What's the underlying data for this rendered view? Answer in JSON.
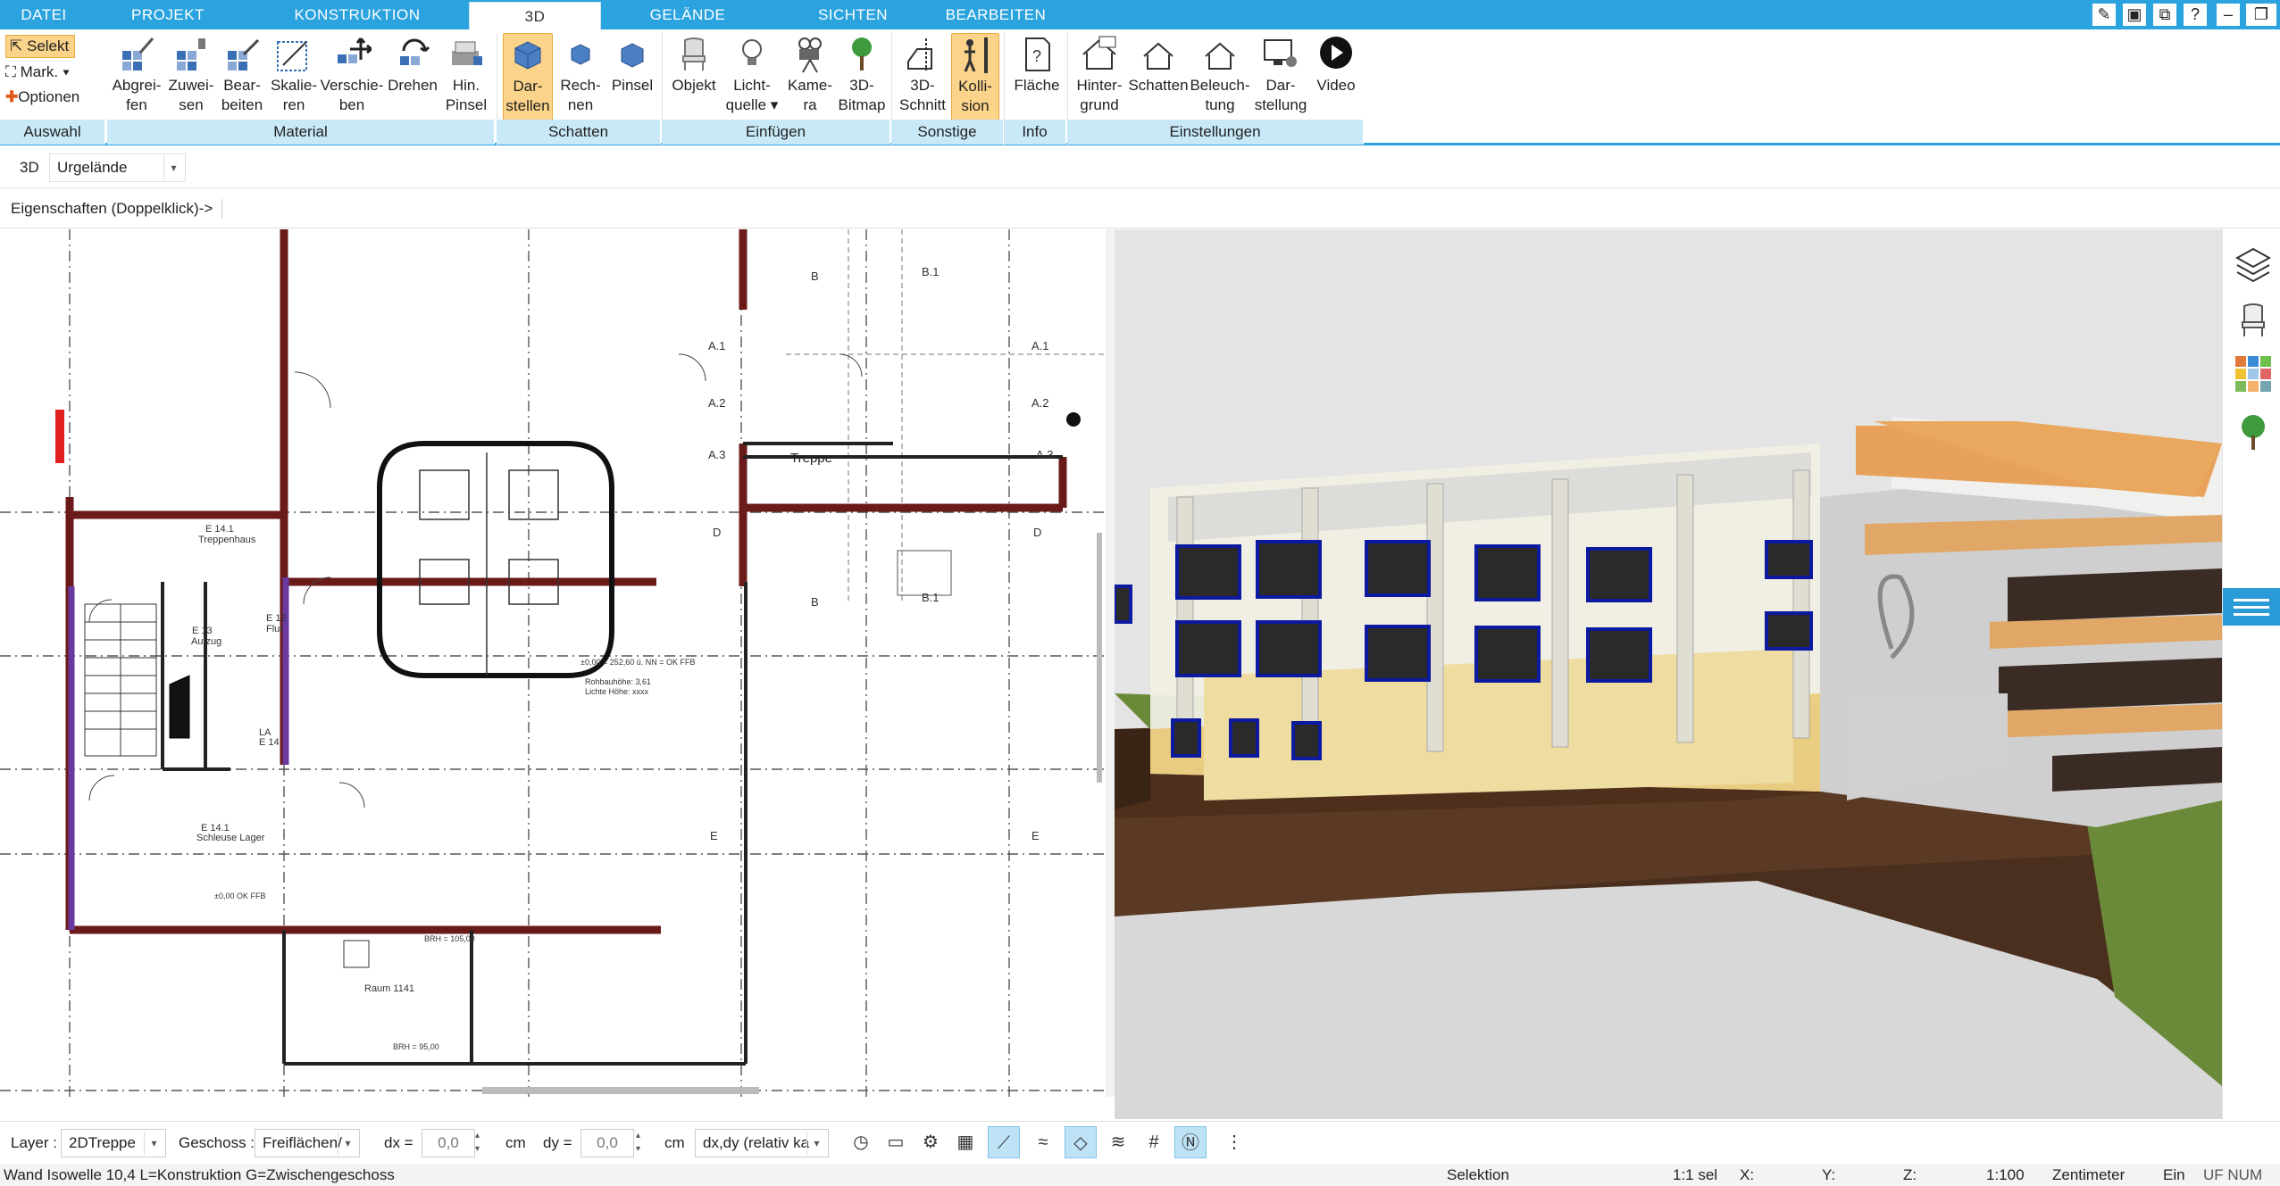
{
  "tabs": [
    "DATEI",
    "PROJEKT",
    "KONSTRUKTION",
    "3D",
    "GELÄNDE",
    "SICHTEN",
    "BEARBEITEN"
  ],
  "window_controls": [
    "tools-icon",
    "screen-icon",
    "restore-icon",
    "help-icon",
    "minimize",
    "restore",
    "close"
  ],
  "ribbon": {
    "auswahl": {
      "selekt": "Selekt",
      "mark": "Mark.",
      "optionen": "Optionen",
      "group": "Auswahl"
    },
    "material": {
      "group": "Material",
      "buttons": [
        [
          "Abgrei-",
          "fen"
        ],
        [
          "Zuwei-",
          "sen"
        ],
        [
          "Bear-",
          "beiten"
        ],
        [
          "Skalie-",
          "ren"
        ],
        [
          "Verschie-",
          "ben"
        ],
        [
          "Drehen",
          ""
        ],
        [
          "Hin.",
          "Pinsel"
        ]
      ]
    },
    "schatten": {
      "group": "Schatten",
      "buttons": [
        [
          "Dar-",
          "stellen"
        ],
        [
          "Rech-",
          "nen"
        ],
        [
          "Pinsel",
          ""
        ]
      ]
    },
    "einfuegen": {
      "group": "Einfügen",
      "buttons": [
        [
          "Objekt",
          ""
        ],
        [
          "Licht-",
          "quelle ▾"
        ],
        [
          "Kame-",
          "ra"
        ],
        [
          "3D-",
          "Bitmap"
        ]
      ]
    },
    "sonstige": {
      "group": "Sonstige",
      "buttons": [
        [
          "3D-",
          "Schnitt"
        ],
        [
          "Kolli-",
          "sion"
        ]
      ]
    },
    "info": {
      "group": "Info",
      "buttons": [
        [
          "Fläche",
          ""
        ]
      ]
    },
    "einstellungen": {
      "group": "Einstellungen",
      "buttons": [
        [
          "Hinter-",
          "grund"
        ],
        [
          "Schatten",
          ""
        ],
        [
          "Beleuch-",
          "tung"
        ],
        [
          "Dar-",
          "stellung"
        ],
        [
          "Video",
          ""
        ]
      ]
    }
  },
  "viewbar": {
    "mode": "3D",
    "terrain": "Urgelände"
  },
  "properties_hint": "Eigenschaften (Doppelklick)->",
  "plan": {
    "labels": [
      "Treppe",
      "A.1",
      "A.2",
      "A.3",
      "B",
      "B.1",
      "D",
      "E",
      "E 14.1",
      "Treppenhaus",
      "E 13",
      "Aufzug",
      "E 12",
      "Flur",
      "LA",
      "E 14",
      "E 14.1",
      "Schleuse Lager",
      "Raum 1141",
      "BRH = 105,00",
      "BRH = 95,00",
      "±0,00 OK FFB",
      "±0,00 = 252,60 ü. NN = OK FFB",
      "Rohbauhöhe: 3,61",
      "Lichte Höhe: xxxx"
    ]
  },
  "bottom": {
    "layer_label": "Layer :",
    "layer_value": "2DTreppe",
    "geschoss_label": "Geschoss :",
    "geschoss_value": "Freiflächen/",
    "dx_label": "dx =",
    "dx_value": "0,0",
    "dx_unit": "cm",
    "dy_label": "dy =",
    "dy_value": "0,0",
    "dy_unit": "cm",
    "mode_value": "dx,dy (relativ ka"
  },
  "status": {
    "left": "Wand Isowelle 10,4 L=Konstruktion G=Zwischengeschoss",
    "mode": "Selektion",
    "sel": "1:1 sel",
    "x": "X:",
    "y": "Y:",
    "z": "Z:",
    "scale": "1:100",
    "unit": "Zentimeter",
    "ein": "Ein",
    "flags": "UF NUM RF"
  },
  "side_icons": [
    "layers-icon",
    "chair-icon",
    "palette-icon",
    "tree-icon",
    "menu-icon"
  ]
}
